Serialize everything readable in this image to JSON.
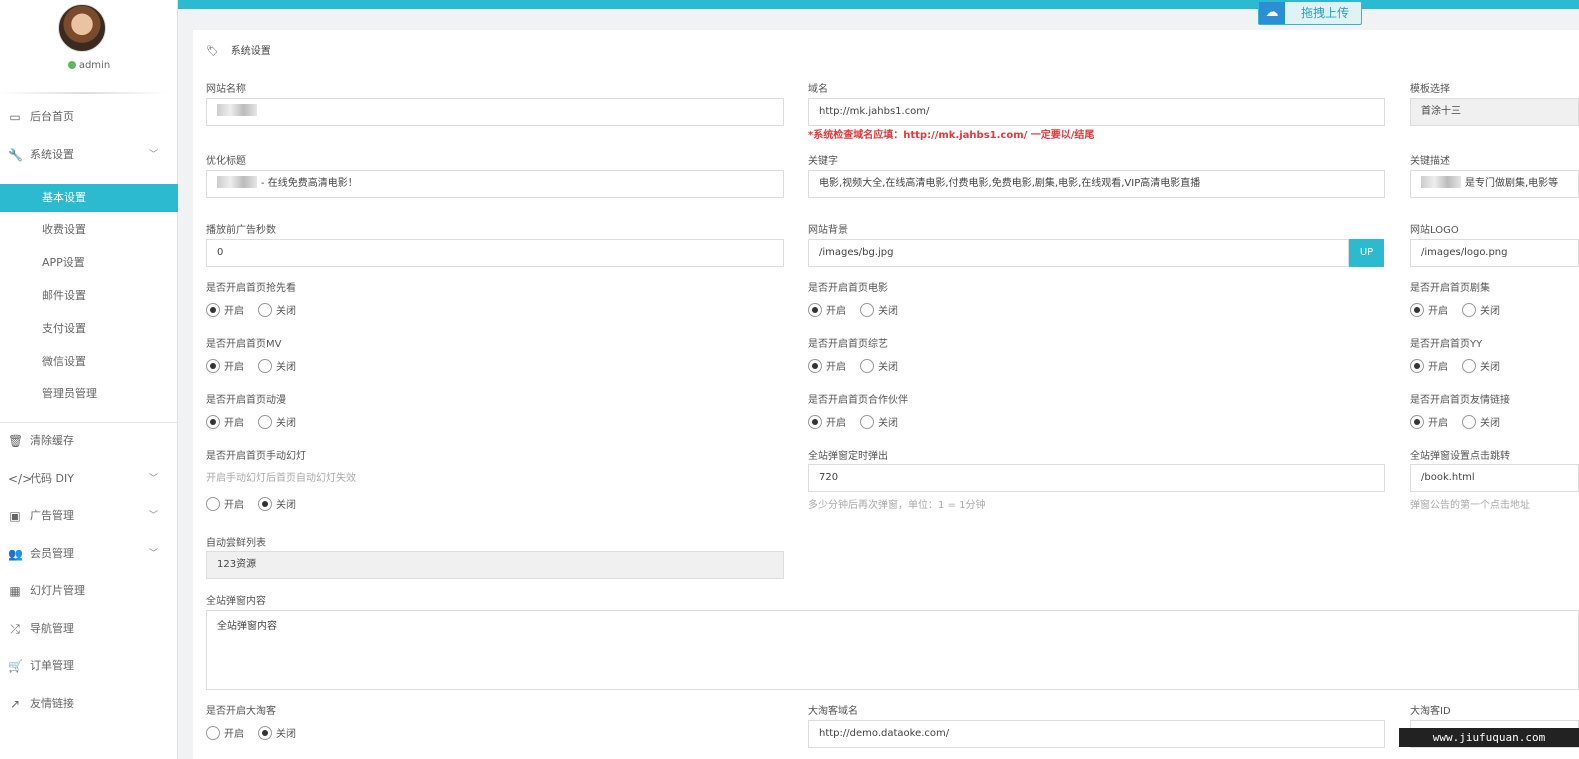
{
  "sidebar": {
    "username": "admin",
    "nav": [
      {
        "label": "后台首页",
        "icon": "laptop-icon"
      },
      {
        "label": "系统设置",
        "icon": "wrench-icon"
      },
      {
        "label": "清除缓存",
        "icon": "trash-icon"
      },
      {
        "label": "代码 DIY",
        "icon": "code-icon"
      },
      {
        "label": "广告管理",
        "icon": "picture-icon"
      },
      {
        "label": "会员管理",
        "icon": "users-icon"
      },
      {
        "label": "幻灯片管理",
        "icon": "table-icon"
      },
      {
        "label": "导航管理",
        "icon": "shuffle-icon"
      },
      {
        "label": "订单管理",
        "icon": "cart-icon"
      },
      {
        "label": "友情链接",
        "icon": "external-link-icon"
      }
    ],
    "sub": [
      "基本设置",
      "收费设置",
      "APP设置",
      "邮件设置",
      "支付设置",
      "微信设置",
      "管理员管理"
    ]
  },
  "upload_button": "拖拽上传",
  "breadcrumb": "系统设置",
  "form": {
    "site_name_label": "网站名称",
    "domain_label": "域名",
    "domain_value": "http://mk.jahbs1.com/",
    "domain_warning": "*系统检查域名应填：http://mk.jahbs1.com/ 一定要以/结尾",
    "template_label": "模板选择",
    "template_value": "首涂十三",
    "seo_title_label": "优化标题",
    "seo_title_value": "- 在线免费高清电影！",
    "keywords_label": "关键字",
    "keywords_value": "电影,视频大全,在线高清电影,付费电影,免费电影,剧集,电影,在线观看,VIP高清电影直播",
    "description_label": "关键描述",
    "description_value": "是专门做剧集,电影等",
    "ad_seconds_label": "播放前广告秒数",
    "ad_seconds_value": "0",
    "bg_label": "网站背景",
    "bg_value": "/images/bg.jpg",
    "up_label": "UP",
    "logo_label": "网站LOGO",
    "logo_value": "/images/logo.png",
    "toggle_preview_label": "是否开启首页抢先看",
    "toggle_movie_label": "是否开启首页电影",
    "toggle_series_label": "是否开启首页剧集",
    "toggle_mv_label": "是否开启首页MV",
    "toggle_variety_label": "是否开启首页综艺",
    "toggle_yy_label": "是否开启首页YY",
    "toggle_anime_label": "是否开启首页动漫",
    "toggle_partner_label": "是否开启首页合作伙伴",
    "toggle_links_label": "是否开启首页友情链接",
    "toggle_slides_label": "是否开启首页手动幻灯",
    "toggle_slides_hint": "开启手动幻灯后首页自动幻灯失效",
    "popup_timer_label": "全站弹窗定时弹出",
    "popup_timer_value": "720",
    "popup_timer_hint": "多少分钟后再次弹窗，单位：1 = 1分钟",
    "popup_click_label": "全站弹窗设置点击跳转",
    "popup_click_value": "/book.html",
    "popup_click_hint": "弹窗公告的第一个点击地址",
    "auto_list_label": "自动尝鲜列表",
    "auto_list_value": "123资源",
    "popup_content_label": "全站弹窗内容",
    "popup_content_value": "全站弹窗内容",
    "dataoke_toggle_label": "是否开启大淘客",
    "dataoke_domain_label": "大淘客域名",
    "dataoke_domain_value": "http://demo.dataoke.com/",
    "dataoke_id_label": "大淘客ID",
    "on_label": "开启",
    "off_label": "关闭"
  },
  "watermark": "www.jiufuquan.com"
}
